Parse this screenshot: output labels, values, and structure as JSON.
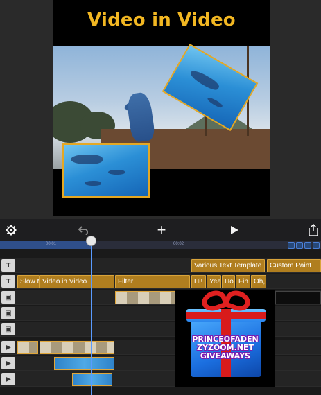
{
  "preview": {
    "title": "Video in Video"
  },
  "toolbar": {
    "settings_icon": "gear-icon",
    "undo_icon": "undo-arrow-icon",
    "add_label": "+",
    "play_icon": "play-icon",
    "share_icon": "share-icon"
  },
  "ruler": {
    "ticks": [
      "00:00",
      "00:01",
      "00:02"
    ]
  },
  "tracks": {
    "text_row_1": {
      "clips": [
        "Various Text Template",
        "Custom Paint"
      ]
    },
    "text_row_2": {
      "clips": [
        "Slow M",
        "Video in Video",
        "Filter",
        "Hi! I",
        "Yea",
        "Ho",
        "Fin",
        "Oh,"
      ]
    }
  },
  "overlay": {
    "lines": [
      "PRINCEOFADEN",
      "ZYZOOM.NET",
      "GIVEAWAYS"
    ]
  },
  "colors": {
    "title_yellow": "#f2b722",
    "clip_gold": "#b07e1f",
    "playhead_blue": "#5a9bff"
  }
}
